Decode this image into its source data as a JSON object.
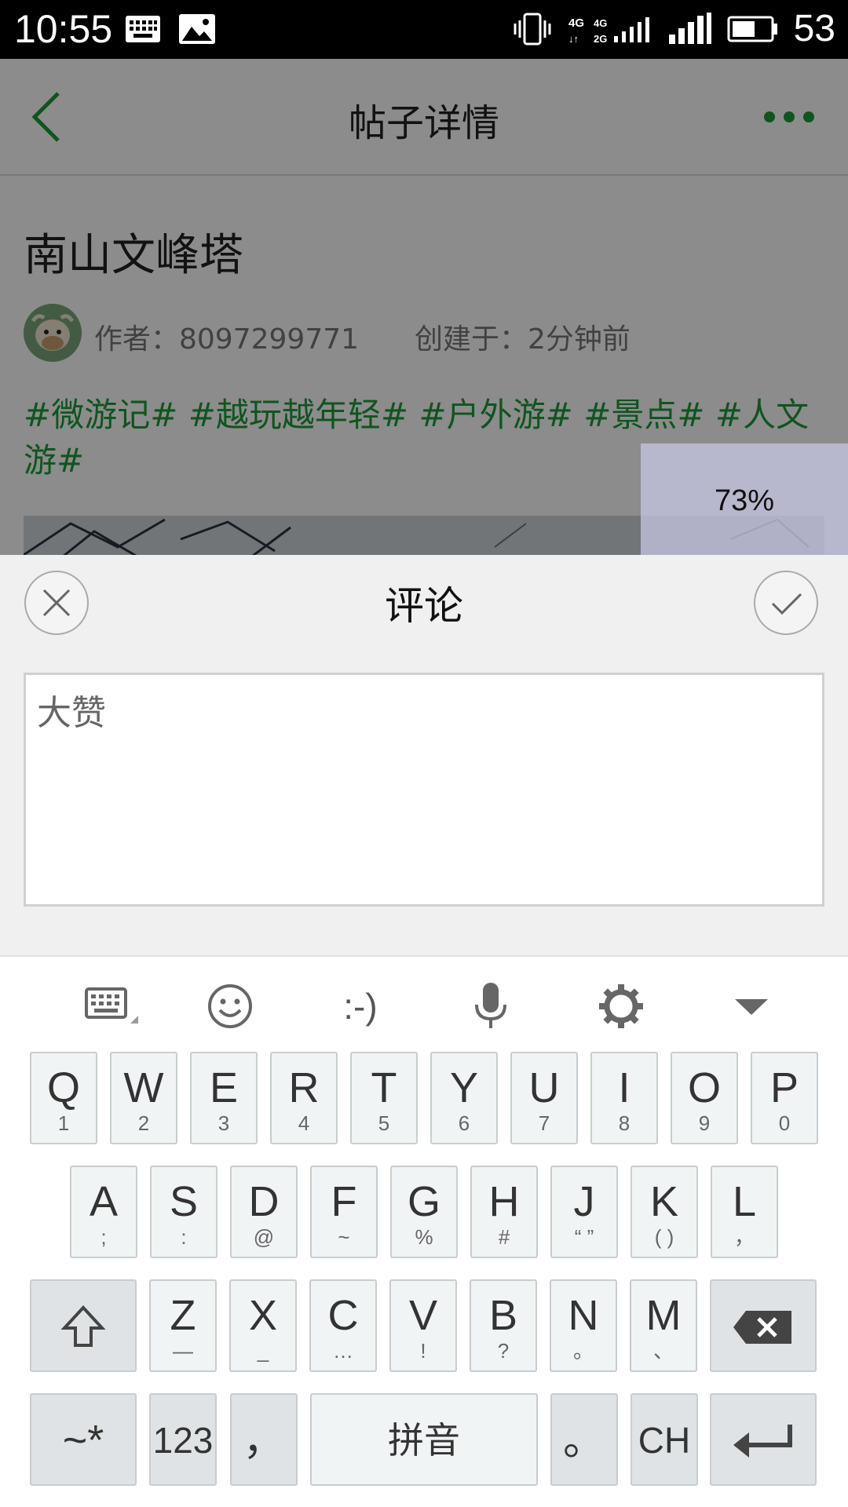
{
  "status_bar": {
    "time": "10:55",
    "battery_percent": "53"
  },
  "page": {
    "nav_title": "帖子详情",
    "post_title": "南山文峰塔",
    "author": "作者：8097299771",
    "created": "创建于：2分钟前",
    "tags": "#微游记# #越玩越年轻# #户外游# #景点# #人文游#"
  },
  "progress": "73%",
  "comment": {
    "title": "评论",
    "text": "大赞"
  },
  "keyboard": {
    "toolbar": {
      "keyboard": "keyboard-switch-icon",
      "emoji": "emoji-icon",
      "emoticon": ":-)",
      "voice": "microphone-icon",
      "settings": "gear-icon",
      "hide": "chevron-down-icon"
    },
    "row1": [
      {
        "main": "Q",
        "sub": "1"
      },
      {
        "main": "W",
        "sub": "2"
      },
      {
        "main": "E",
        "sub": "3"
      },
      {
        "main": "R",
        "sub": "4"
      },
      {
        "main": "T",
        "sub": "5"
      },
      {
        "main": "Y",
        "sub": "6"
      },
      {
        "main": "U",
        "sub": "7"
      },
      {
        "main": "I",
        "sub": "8"
      },
      {
        "main": "O",
        "sub": "9"
      },
      {
        "main": "P",
        "sub": "0"
      }
    ],
    "row2": [
      {
        "main": "A",
        "sub": ";"
      },
      {
        "main": "S",
        "sub": ":"
      },
      {
        "main": "D",
        "sub": "@"
      },
      {
        "main": "F",
        "sub": "~"
      },
      {
        "main": "G",
        "sub": "%"
      },
      {
        "main": "H",
        "sub": "#"
      },
      {
        "main": "J",
        "sub": "“ ”"
      },
      {
        "main": "K",
        "sub": "( )"
      },
      {
        "main": "L",
        "sub": "，"
      }
    ],
    "row3": [
      {
        "main": "Z",
        "sub": "—"
      },
      {
        "main": "X",
        "sub": "_"
      },
      {
        "main": "C",
        "sub": "…"
      },
      {
        "main": "V",
        "sub": "!"
      },
      {
        "main": "B",
        "sub": "?"
      },
      {
        "main": "N",
        "sub": "。"
      },
      {
        "main": "M",
        "sub": "、"
      }
    ],
    "bottom": {
      "symbols": "~*",
      "numbers": "123",
      "comma": "，",
      "space": "拼音",
      "period": "。",
      "lang": "CH"
    }
  }
}
